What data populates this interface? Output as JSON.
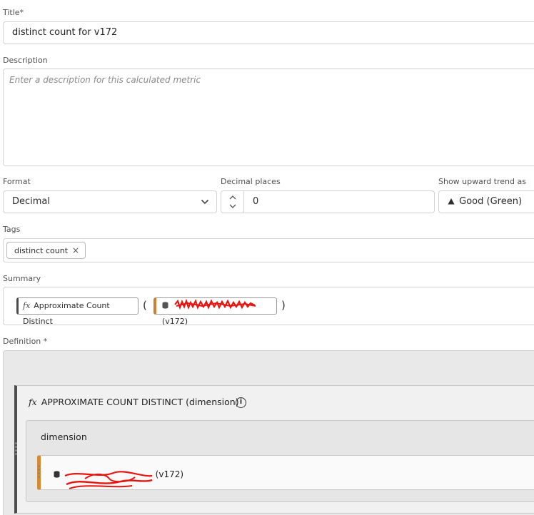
{
  "title": {
    "label": "Title",
    "required_mark": "*",
    "value": "distinct count for v172"
  },
  "description": {
    "label": "Description",
    "placeholder": "Enter a description for this calculated metric"
  },
  "format": {
    "label": "Format",
    "value": "Decimal"
  },
  "decimal_places": {
    "label": "Decimal places",
    "value": "0"
  },
  "trend": {
    "label": "Show upward trend as",
    "value": "Good (Green)",
    "icon": "triangle-up-icon"
  },
  "tags": {
    "label": "Tags",
    "items": [
      {
        "label": "distinct count",
        "remove": "×"
      }
    ]
  },
  "summary": {
    "label": "Summary",
    "function_label": "Approximate Count Distinct",
    "dimension_suffix": "(v172)",
    "open_paren": "(",
    "close_paren": ")"
  },
  "definition": {
    "label": "Definition",
    "required_mark": "*",
    "function_title": "APPROXIMATE COUNT DISTINCT (dimension)",
    "dimension_label": "dimension",
    "dimension_suffix": "(v172)"
  },
  "colors": {
    "accent_dimension": "#d8882e",
    "redaction": "#e8140f"
  }
}
